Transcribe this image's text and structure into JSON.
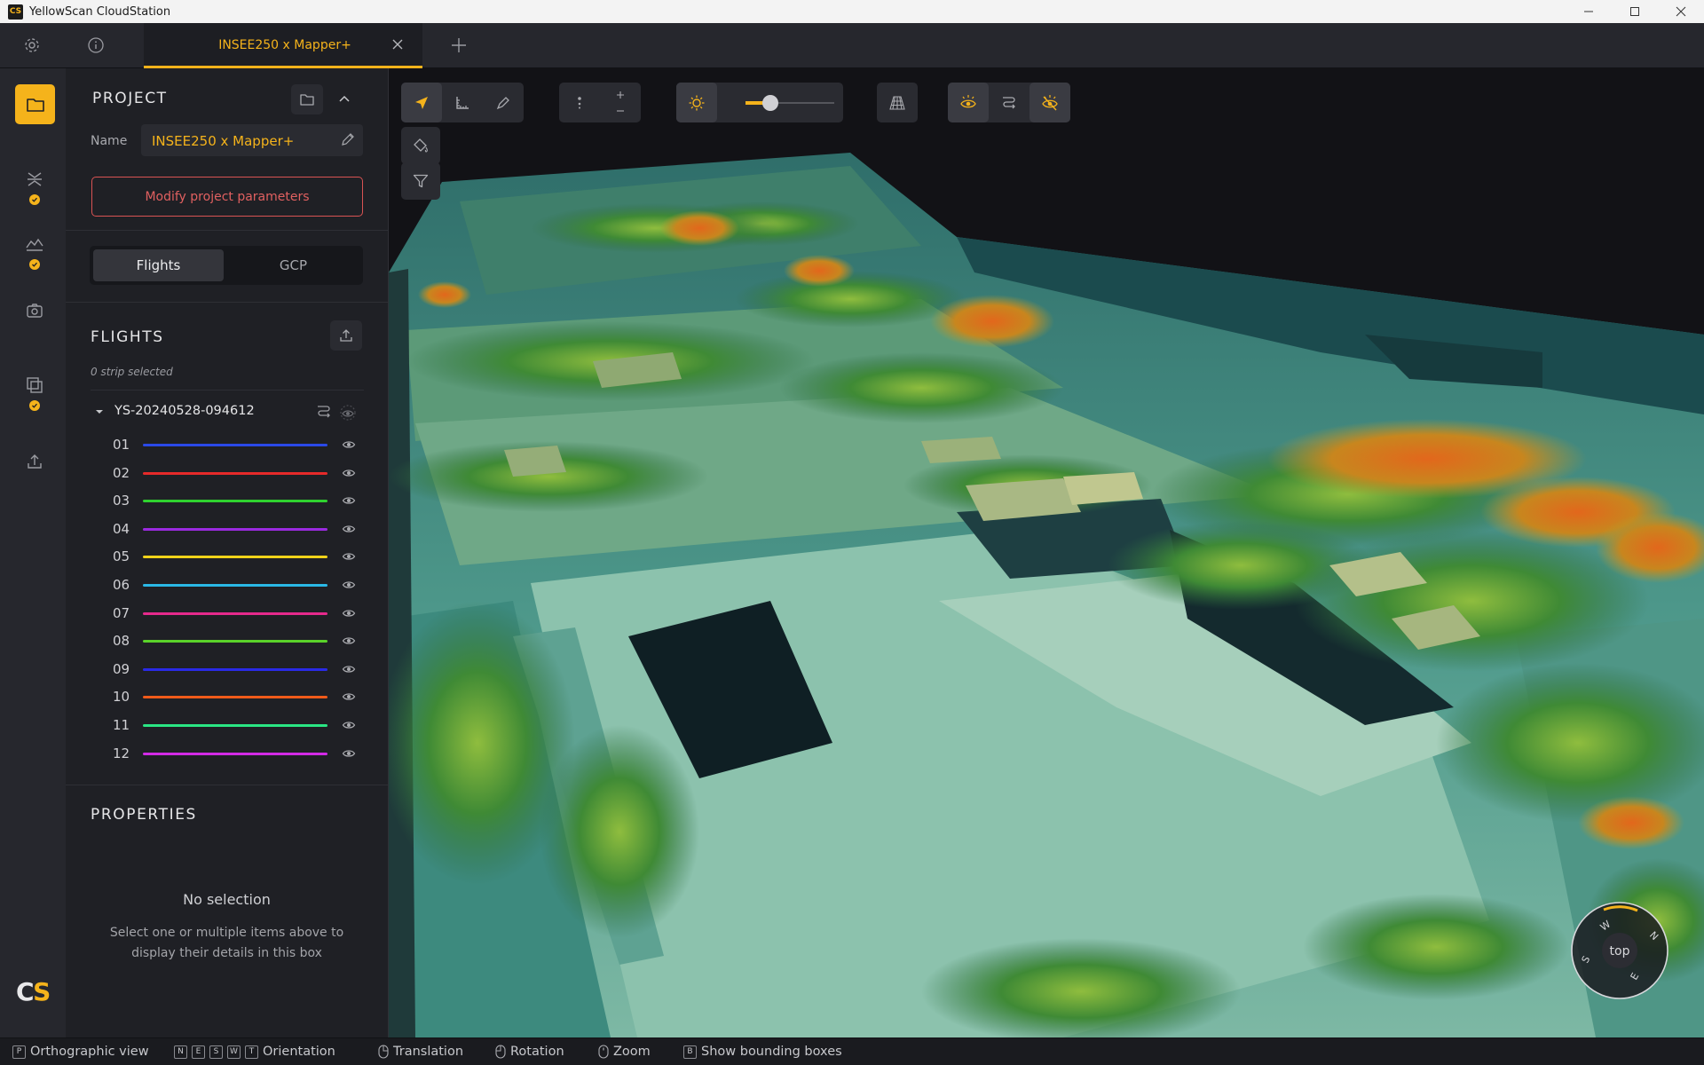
{
  "window": {
    "title": "YellowScan CloudStation",
    "logo_text": "CS"
  },
  "tabs": {
    "active_tab_label": "INSEE250 x Mapper+"
  },
  "project": {
    "section_title": "PROJECT",
    "name_label": "Name",
    "name_value": "INSEE250 x Mapper+",
    "modify_button": "Modify project parameters"
  },
  "segmented": {
    "flights": "Flights",
    "gcp": "GCP"
  },
  "flights": {
    "section_title": "FLIGHTS",
    "strip_status": "0 strip selected",
    "flight_name": "YS-20240528-094612",
    "strips": [
      {
        "id": "01",
        "color": "#2a49e8"
      },
      {
        "id": "02",
        "color": "#e62a2a"
      },
      {
        "id": "03",
        "color": "#2fd22f"
      },
      {
        "id": "04",
        "color": "#9a2ae0"
      },
      {
        "id": "05",
        "color": "#f0d21a"
      },
      {
        "id": "06",
        "color": "#2ab8e6"
      },
      {
        "id": "07",
        "color": "#e62a8c"
      },
      {
        "id": "08",
        "color": "#5ad22a"
      },
      {
        "id": "09",
        "color": "#2a2ae6"
      },
      {
        "id": "10",
        "color": "#f05a1a"
      },
      {
        "id": "11",
        "color": "#2ae684"
      },
      {
        "id": "12",
        "color": "#d22ae6"
      }
    ]
  },
  "properties": {
    "section_title": "PROPERTIES",
    "empty_title": "No selection",
    "empty_desc": "Select one or multiple items above to display their details in this box"
  },
  "viewport": {
    "brightness_level": 0.28,
    "compass_center": "top",
    "compass_dirs": [
      "W",
      "N",
      "S",
      "E"
    ]
  },
  "statusbar": {
    "ortho": {
      "keys": [
        "P"
      ],
      "label": "Orthographic view"
    },
    "orientation": {
      "keys": [
        "N",
        "E",
        "S",
        "W",
        "T"
      ],
      "label": "Orientation"
    },
    "translation": "Translation",
    "rotation": "Rotation",
    "zoom": "Zoom",
    "bbox": {
      "keys": [
        "B"
      ],
      "label": "Show bounding boxes"
    }
  },
  "colors": {
    "accent": "#f5b31b",
    "danger": "#e06060",
    "panel_bg": "#1f2025"
  }
}
